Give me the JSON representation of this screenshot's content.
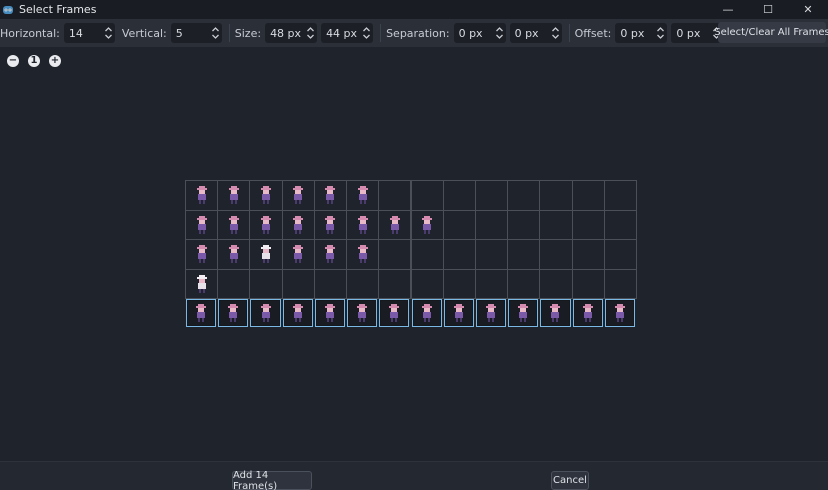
{
  "window": {
    "title": "Select Frames",
    "minimize_glyph": "—",
    "maximize_glyph": "☐",
    "close_glyph": "✕"
  },
  "toolbar": {
    "horizontal_label": "Horizontal:",
    "horizontal_value": "14",
    "vertical_label": "Vertical:",
    "vertical_value": "5",
    "size_label": "Size:",
    "size_w": "48 px",
    "size_h": "44 px",
    "separation_label": "Separation:",
    "separation_x": "0 px",
    "separation_y": "0 px",
    "offset_label": "Offset:",
    "offset_x": "0 px",
    "offset_y": "0 px",
    "select_clear_label": "Select/Clear All Frames"
  },
  "zoom": {
    "out_glyph": "−",
    "reset_glyph": "1",
    "in_glyph": "+"
  },
  "grid": {
    "columns": 14,
    "rows": 5,
    "sprites_per_row": [
      6,
      8,
      6,
      1,
      14
    ],
    "selected_row": 4
  },
  "colors": {
    "accent": "#7ab8e6",
    "sprite_hat": "#d58bb0",
    "sprite_body": "#7a5aa8",
    "sprite_dark": "#4b3a6e"
  },
  "footer": {
    "add_label": "Add 14 Frame(s)",
    "cancel_label": "Cancel"
  }
}
